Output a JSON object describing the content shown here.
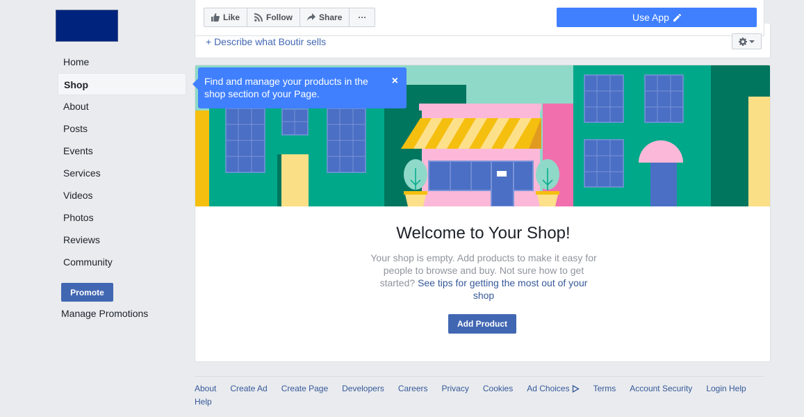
{
  "nav": {
    "items": [
      {
        "label": "Home",
        "active": false
      },
      {
        "label": "Shop",
        "active": true
      },
      {
        "label": "About",
        "active": false
      },
      {
        "label": "Posts",
        "active": false
      },
      {
        "label": "Events",
        "active": false
      },
      {
        "label": "Services",
        "active": false
      },
      {
        "label": "Videos",
        "active": false
      },
      {
        "label": "Photos",
        "active": false
      },
      {
        "label": "Reviews",
        "active": false
      },
      {
        "label": "Community",
        "active": false
      }
    ],
    "promote_label": "Promote",
    "manage_promotions_label": "Manage Promotions"
  },
  "actions": {
    "like_label": "Like",
    "follow_label": "Follow",
    "share_label": "Share",
    "more_label": "···",
    "use_app_label": "Use App"
  },
  "describe": {
    "label": "+ Describe what Boutir sells"
  },
  "tooltip": {
    "text": "Find and manage your products in the shop section of your Page.",
    "close_label": "×"
  },
  "shop": {
    "title": "Welcome to Your Shop!",
    "body": "Your shop is empty. Add products to make it easy for people to browse and buy. Not sure how to get started? ",
    "tips_link": "See tips for getting the most out of your shop",
    "add_product_label": "Add Product"
  },
  "footer": {
    "links": [
      "About",
      "Create Ad",
      "Create Page",
      "Developers",
      "Careers",
      "Privacy",
      "Cookies",
      "Ad Choices",
      "Terms",
      "Account Security",
      "Login Help",
      "Help"
    ]
  },
  "colors": {
    "brand_blue": "#4267b2",
    "accent_blue": "#4080ff",
    "logo_navy": "#00247d",
    "page_bg": "#e9ebee"
  },
  "icons": {
    "like": "thumbs-up-icon",
    "follow": "rss-icon",
    "share": "share-arrow-icon",
    "use_app": "pencil-icon",
    "settings": "gear-icon",
    "ad_choices": "ad-choices-icon"
  }
}
